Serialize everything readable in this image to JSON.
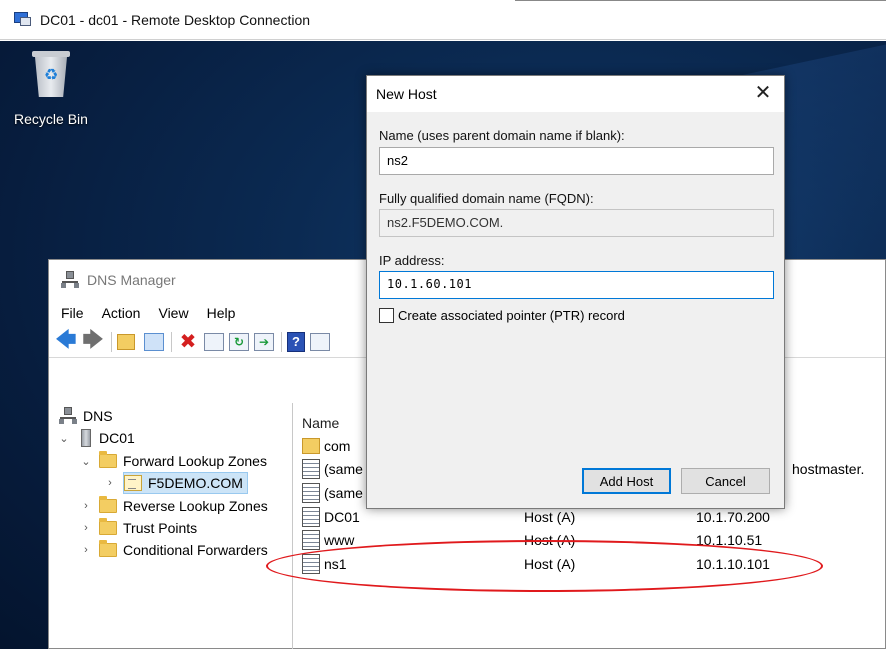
{
  "rdp": {
    "title": "DC01 - dc01 - Remote Desktop Connection"
  },
  "desktop": {
    "recycle_bin_label": "Recycle Bin"
  },
  "dns_manager": {
    "title": "DNS Manager",
    "menu": [
      "File",
      "Action",
      "View",
      "Help"
    ],
    "tree": {
      "root": "DNS",
      "server": "DC01",
      "forward_zones": "Forward Lookup Zones",
      "zone": "F5DEMO.COM",
      "reverse_zones": "Reverse Lookup Zones",
      "trust_points": "Trust Points",
      "conditional_forwarders": "Conditional Forwarders"
    },
    "list": {
      "header_name": "Name",
      "rows": [
        {
          "name": "com",
          "type": "",
          "data": ""
        },
        {
          "name": "(same",
          "type": "",
          "data": "hostmaster."
        },
        {
          "name": "(same",
          "type": "",
          "data": ""
        },
        {
          "name": "DC01",
          "type": "Host (A)",
          "data": "10.1.70.200"
        },
        {
          "name": "www",
          "type": "Host (A)",
          "data": "10.1.10.51"
        },
        {
          "name": "ns1",
          "type": "Host (A)",
          "data": "10.1.10.101"
        }
      ]
    }
  },
  "dialog": {
    "title": "New Host",
    "name_label": "Name (uses parent domain name if blank):",
    "name_value": "ns2",
    "fqdn_label": "Fully qualified domain name (FQDN):",
    "fqdn_value": "ns2.F5DEMO.COM.",
    "ip_label": "IP address:",
    "ip_value": "10.1.60.101",
    "ptr_label": "Create associated pointer (PTR) record",
    "ptr_checked": false,
    "add_button": "Add Host",
    "cancel_button": "Cancel",
    "close_glyph": "✕"
  },
  "colors": {
    "annotation": "#e0191c",
    "focus": "#0078d7"
  }
}
